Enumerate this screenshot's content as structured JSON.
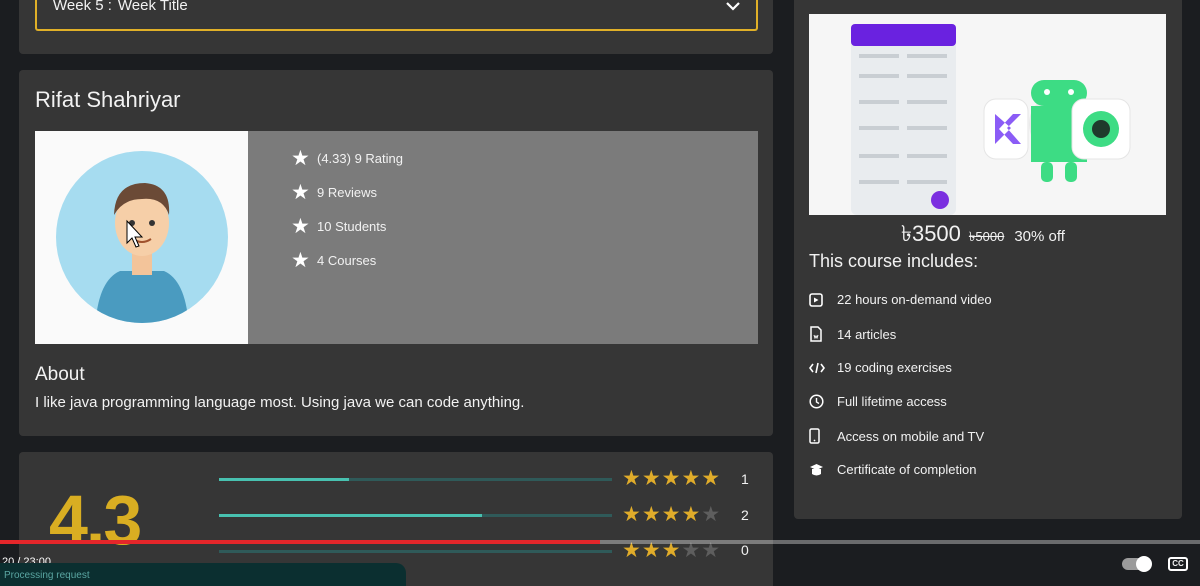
{
  "week": {
    "label": "Week 5 :",
    "title": "Week Title"
  },
  "instructor": {
    "name": "Rifat Shahriyar",
    "stats": [
      "(4.33) 9 Rating",
      "9 Reviews",
      "10 Students",
      "4 Courses"
    ],
    "about_heading": "About",
    "about_text": "I like java programming language most. Using java we can code anything."
  },
  "ratings": {
    "average": "4.3",
    "rows": [
      {
        "stars": 5,
        "count": "1",
        "fill": 0.33
      },
      {
        "stars": 4,
        "count": "2",
        "fill": 0.67
      },
      {
        "stars": 3,
        "count": "0",
        "fill": 0.0
      }
    ]
  },
  "course": {
    "price": "৳3500",
    "old_price": "৳5000",
    "discount": "30% off",
    "includes_heading": "This course includes:",
    "includes": [
      {
        "icon": "video-icon",
        "label": "22 hours on-demand video"
      },
      {
        "icon": "article-icon",
        "label": "14 articles"
      },
      {
        "icon": "code-icon",
        "label": "19 coding exercises"
      },
      {
        "icon": "clock-icon",
        "label": "Full lifetime access"
      },
      {
        "icon": "mobile-icon",
        "label": "Access on mobile and TV"
      },
      {
        "icon": "certificate-icon",
        "label": "Certificate of completion"
      }
    ]
  },
  "player": {
    "time": "20 / 23:00",
    "progress": 0.5,
    "status": "Processing request"
  },
  "colors": {
    "accent": "#e0b028",
    "teal": "#48c1b0",
    "star": "#e0ac2a"
  }
}
